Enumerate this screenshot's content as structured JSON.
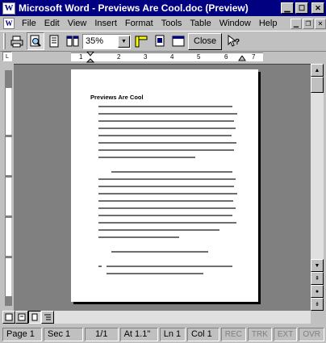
{
  "window": {
    "title": "Microsoft Word - Previews Are Cool.doc (Preview)",
    "app_icon": "W",
    "controls": {
      "minimize_icon": "minimize-icon",
      "maximize_icon": "maximize-icon",
      "close_icon": "close-icon"
    }
  },
  "menu": {
    "items": [
      {
        "label": "File"
      },
      {
        "label": "Edit"
      },
      {
        "label": "View"
      },
      {
        "label": "Insert"
      },
      {
        "label": "Format"
      },
      {
        "label": "Tools"
      },
      {
        "label": "Table"
      },
      {
        "label": "Window"
      },
      {
        "label": "Help"
      }
    ]
  },
  "toolbar": {
    "zoom_value": "35%",
    "close_label": "Close",
    "buttons": [
      "print-icon",
      "magnifier-icon",
      "one-page-icon",
      "multiple-pages-icon",
      "view-ruler-icon",
      "shrink-to-fit-icon",
      "full-screen-icon",
      "context-help-icon"
    ]
  },
  "ruler": {
    "numbers": [
      "1",
      "2",
      "3",
      "4",
      "5",
      "6",
      "7"
    ]
  },
  "document": {
    "title": "Previews Are Cool"
  },
  "statusbar": {
    "page": "Page  1",
    "sec": "Sec  1",
    "pages": "1/1",
    "at": "At  1.1\"",
    "ln": "Ln  1",
    "col": "Col  1",
    "rec": "REC",
    "trk": "TRK",
    "ext": "EXT",
    "ovr": "OVR"
  },
  "colors": {
    "titlebar": "#000080",
    "chrome": "#c0c0c0",
    "workspace": "#808080"
  }
}
